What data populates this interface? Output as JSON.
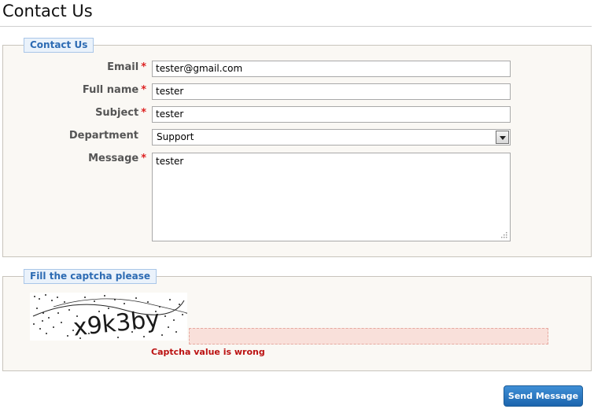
{
  "page": {
    "title": "Contact Us"
  },
  "contact_form": {
    "legend": "Contact Us",
    "email": {
      "label": "Email",
      "required": "*",
      "value": "tester@gmail.com"
    },
    "full_name": {
      "label": "Full name",
      "required": "*",
      "value": "tester"
    },
    "subject": {
      "label": "Subject",
      "required": "*",
      "value": "tester"
    },
    "department": {
      "label": "Department",
      "selected": "Support"
    },
    "message": {
      "label": "Message",
      "required": "*",
      "value": "tester"
    }
  },
  "captcha": {
    "legend": "Fill the captcha please",
    "image_text": "x9k3by",
    "input_value": "",
    "error": "Captcha value is wrong"
  },
  "actions": {
    "send_label": "Send Message"
  },
  "colors": {
    "accent": "#2d6bb3",
    "required": "#dd2222",
    "error": "#bb1111",
    "error_input_bg": "#f9e0da",
    "button": "#2a7bc6"
  }
}
